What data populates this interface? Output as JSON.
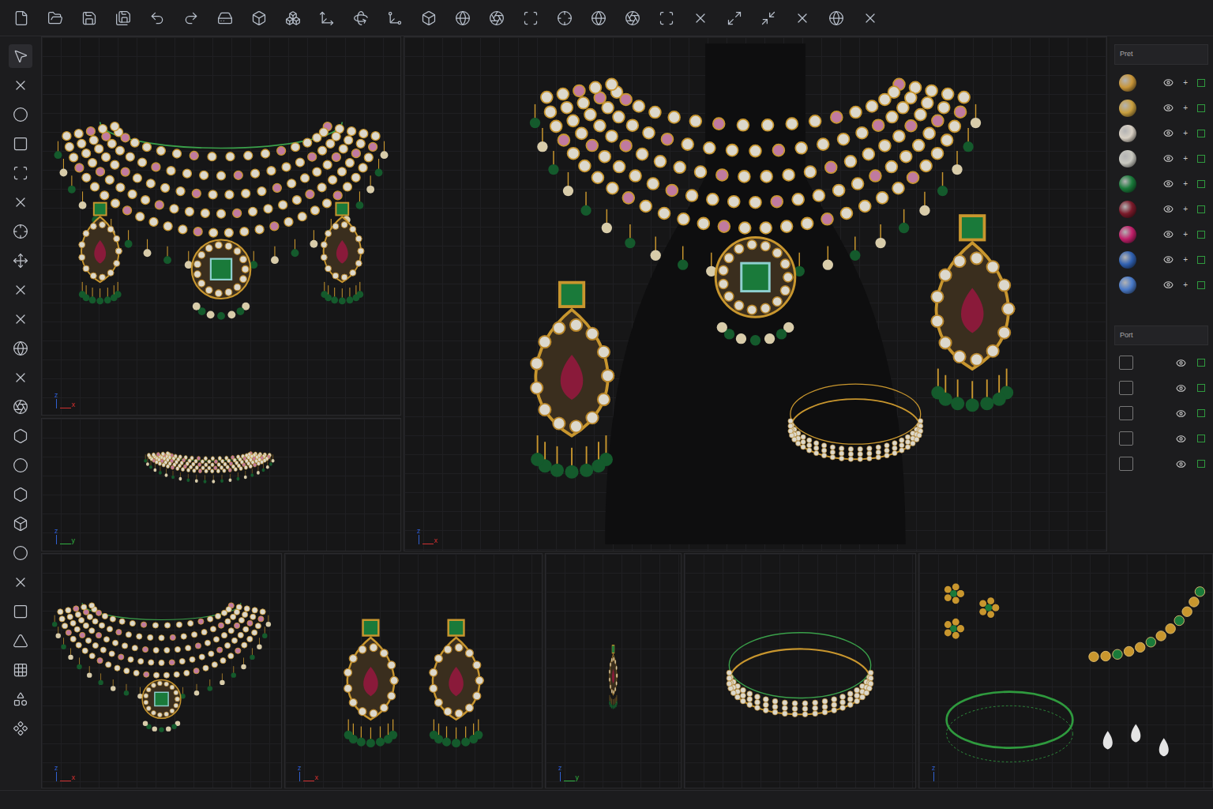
{
  "viewports": [
    {
      "name": "front-view",
      "kind": "necklace",
      "axes": [
        "z",
        "x"
      ]
    },
    {
      "name": "side-view",
      "kind": "choker",
      "axes": [
        "z",
        "y"
      ]
    },
    {
      "name": "render-view",
      "kind": "render",
      "axes": [
        "z",
        "x"
      ]
    },
    {
      "name": "top-view",
      "kind": "collar",
      "axes": [
        "z",
        "x"
      ]
    },
    {
      "name": "earrings-view",
      "kind": "earrings",
      "axes": [
        "z",
        "x"
      ]
    },
    {
      "name": "earring-side-view",
      "kind": "earring-side",
      "axes": [
        "z",
        "y"
      ]
    },
    {
      "name": "bangle-view",
      "kind": "bangle",
      "axes": []
    },
    {
      "name": "parts-view",
      "kind": "parts",
      "axes": [
        "z"
      ]
    }
  ],
  "materials_panel": {
    "title": "Pret",
    "items": [
      {
        "color": "#c8963a",
        "visible": true,
        "action": "+"
      },
      {
        "color": "#c9a040",
        "visible": true,
        "action": "+"
      },
      {
        "color": "#d8d0c4",
        "visible": true,
        "action": "+"
      },
      {
        "color": "#c8c8c0",
        "visible": true,
        "action": "+"
      },
      {
        "color": "#1a7a3a",
        "visible": true,
        "action": "+"
      },
      {
        "color": "#7a1a2a",
        "visible": true,
        "action": "+"
      },
      {
        "color": "#c0206a",
        "visible": true,
        "action": "+"
      },
      {
        "color": "#3060b0",
        "visible": true,
        "action": "+"
      },
      {
        "color": "#4a7ac8",
        "visible": true,
        "action": "+"
      }
    ]
  },
  "layers_panel": {
    "title": "Port",
    "items": [
      {
        "visible": true
      },
      {
        "visible": true
      },
      {
        "visible": true
      },
      {
        "visible": true
      },
      {
        "visible": true
      }
    ]
  }
}
